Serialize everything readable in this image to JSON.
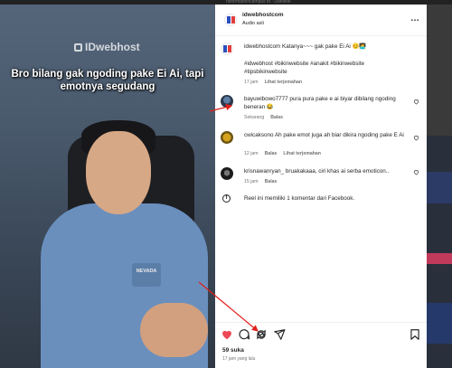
{
  "top_strip": "nsformationcampus id · Danielle",
  "video": {
    "watermark": "IDwebhost",
    "caption": "Bro bilang gak ngoding pake Ei Ai, tapi emotnya segudang",
    "shirt_text": "NEVADA"
  },
  "post": {
    "username": "idwebhostcom",
    "audio_label": "Audio asli",
    "more_label": "…",
    "caption": {
      "username": "idwebhostcom",
      "text": "Katanya~~~ gak pake Ei Ai 😊🧑‍💻",
      "hashtags": "#idwebhost #bikinwebsite #anakit #bikinwebsite #tipsbikinwebsite",
      "time": "17 jam",
      "translate": "Lihat terjemahan"
    },
    "comments": [
      {
        "username": "bayuwibowo7777",
        "text": "pura pura pake e ai biyar dibilang ngoding beneran 😂",
        "time": "Sekarang",
        "reply": "Balas",
        "translate": ""
      },
      {
        "username": "cwicaksono",
        "text": "Ah pake emot juga ah biar dikira ngoding pake E Ai",
        "time": "12 jam",
        "reply": "Balas",
        "translate": "Lihat terjemahan"
      },
      {
        "username": "krisnawanryan_",
        "text": "bruakakaaa, ciri khas ai serba emoticon..",
        "time": "15 jam",
        "reply": "Balas",
        "translate": ""
      }
    ],
    "facebook_note": "Reel ini memiliki 1 komentar dari Facebook.",
    "likes": "59 suka",
    "posted_ago": "17 jam yang lalu"
  },
  "colors": {
    "like_red": "#ed4956",
    "link_blue": "#00376b",
    "annotation_red": "#e0201b"
  }
}
